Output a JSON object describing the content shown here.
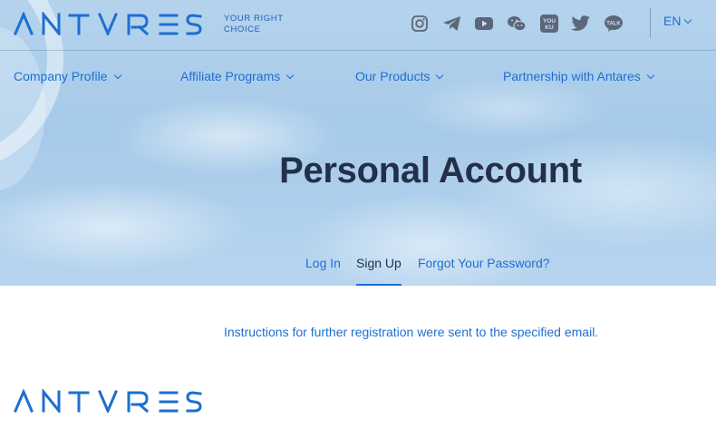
{
  "brand": {
    "accent": "#1e6fd0",
    "title_color": "#23304a"
  },
  "header": {
    "logo_text": "ANTVRES",
    "tagline": "YOUR RIGHT CHOICE",
    "social_icons": [
      "instagram-icon",
      "telegram-icon",
      "youtube-icon",
      "wechat-icon",
      "youku-icon",
      "twitter-icon",
      "kakaotalk-icon"
    ],
    "youku_label": "YOU KU",
    "kakao_label": "TALK",
    "language": "EN"
  },
  "nav": {
    "items": [
      {
        "label": "Company Profile"
      },
      {
        "label": "Affiliate Programs"
      },
      {
        "label": "Our Products"
      },
      {
        "label": "Partnership with Antares"
      }
    ]
  },
  "main": {
    "title": "Personal Account",
    "tabs": [
      {
        "label": "Log In",
        "active": false
      },
      {
        "label": "Sign Up",
        "active": true
      },
      {
        "label": "Forgot Your Password?",
        "active": false
      }
    ],
    "message": "Instructions for further registration were sent to the specified email."
  },
  "footer": {
    "logo_text": "ANTVRES"
  }
}
